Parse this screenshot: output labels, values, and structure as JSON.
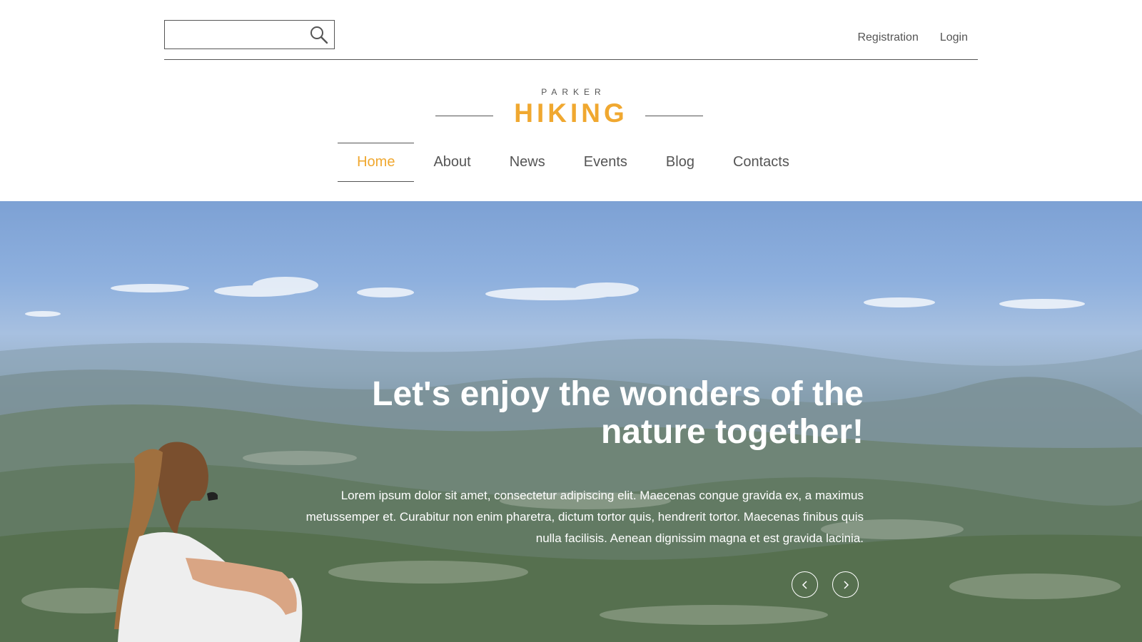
{
  "search": {
    "placeholder": "",
    "value": "",
    "icon": "search-icon"
  },
  "top_links": {
    "registration": "Registration",
    "login": "Login"
  },
  "logo": {
    "small": "PARKER",
    "main": "HIKING"
  },
  "nav": {
    "items": [
      {
        "label": "Home",
        "active": true
      },
      {
        "label": "About",
        "active": false
      },
      {
        "label": "News",
        "active": false
      },
      {
        "label": "Events",
        "active": false
      },
      {
        "label": "Blog",
        "active": false
      },
      {
        "label": "Contacts",
        "active": false
      }
    ]
  },
  "hero": {
    "title_line1": "Let's enjoy the wonders of the",
    "title_line2": "nature together!",
    "text": "Lorem ipsum dolor sit amet, consectetur adipiscing elit. Maecenas congue gravida ex, a maximus metussemper et. Curabitur non enim pharetra, dictum tortor quis, hendrerit tortor. Maecenas finibus quis nulla facilisis. Aenean dignissim magna et est gravida lacinia.",
    "prev_icon": "chevron-left-icon",
    "next_icon": "chevron-right-icon"
  },
  "colors": {
    "accent": "#f0a830",
    "text": "#555555",
    "hero_text": "#ffffff"
  }
}
